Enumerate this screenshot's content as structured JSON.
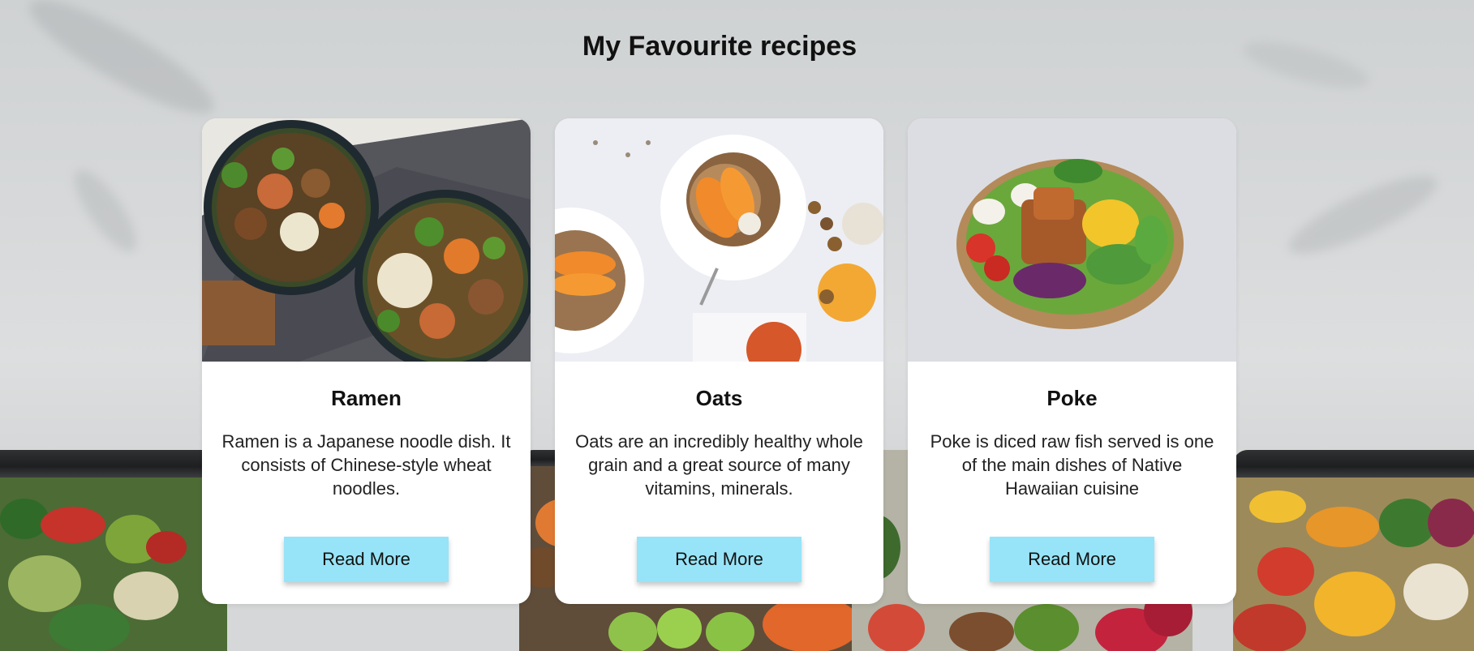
{
  "page": {
    "title": "My Favourite recipes"
  },
  "cards": [
    {
      "title": "Ramen",
      "description": "Ramen is a Japanese noodle dish. It consists of Chinese-style wheat noodles.",
      "button_label": "Read More"
    },
    {
      "title": "Oats",
      "description": "Oats are an incredibly healthy whole grain and a great source of many vitamins, minerals.",
      "button_label": "Read More"
    },
    {
      "title": "Poke",
      "description": "Poke is diced raw fish served is one of the main dishes of Native Hawaiian cuisine",
      "button_label": "Read More"
    }
  ],
  "colors": {
    "button_bg": "#97e4f8",
    "card_bg": "#ffffff",
    "background": "#d7d9da"
  }
}
